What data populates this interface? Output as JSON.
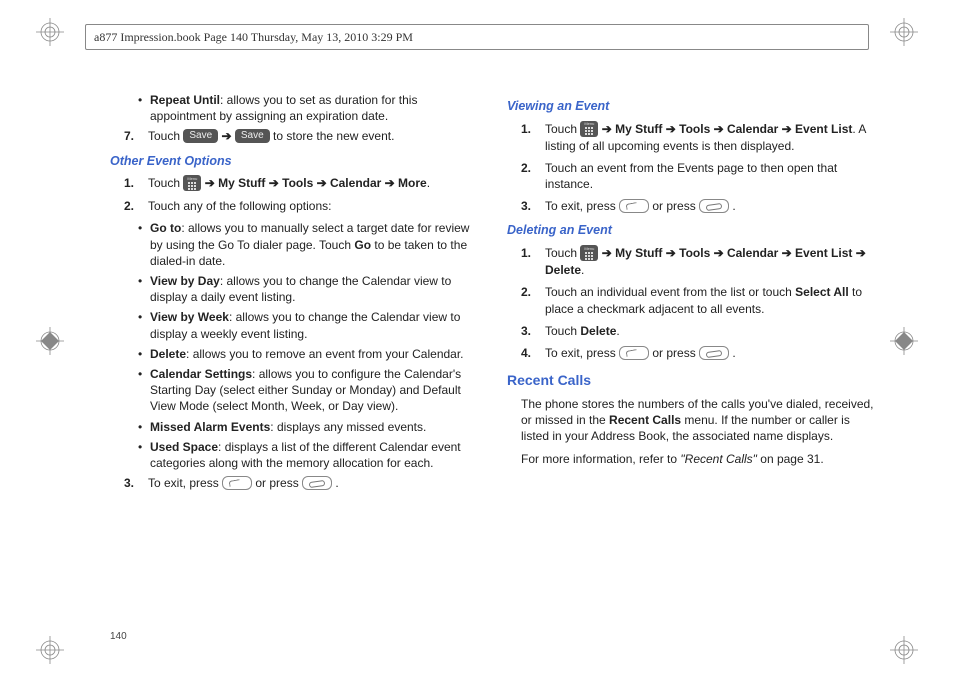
{
  "header": "a877 Impression.book  Page 140  Thursday, May 13, 2010  3:29 PM",
  "page_number": "140",
  "btn": {
    "save": "Save",
    "menu": "Menu"
  },
  "left": {
    "repeat_until_b": "Repeat Until",
    "repeat_until_t": ": allows you to set as duration for this appointment by assigning an expiration date.",
    "step7_n": "7.",
    "step7_a": "Touch ",
    "step7_b": " to store the new event.",
    "h_other": "Other Event Options",
    "s1_n": "1.",
    "s1_a": "Touch ",
    "s1_b": " ➔ My Stuff ➔ Tools ➔ Calendar ➔ More",
    "s1_c": ".",
    "s2_n": "2.",
    "s2_t": "Touch any of the following options:",
    "goto_b": "Go to",
    "goto_t": ": allows you to manually select a target date for review by using the Go To dialer page. Touch ",
    "goto_go": "Go",
    "goto_t2": " to be taken to the dialed-in date.",
    "vbd_b": "View by Day",
    "vbd_t": ": allows you to change the Calendar view to display a daily event listing.",
    "vbw_b": "View by Week",
    "vbw_t": ": allows you to change the Calendar view to display a weekly event listing.",
    "del_b": "Delete",
    "del_t": ": allows you to remove an event from your Calendar.",
    "cs_b": "Calendar Settings",
    "cs_t": ": allows you to configure the Calendar's Starting Day (select either Sunday or Monday) and Default View Mode (select Month, Week, or Day view).",
    "mae_b": "Missed Alarm Events",
    "mae_t": ": displays any missed events.",
    "us_b": "Used Space",
    "us_t": ": displays a list of the different Calendar event categories along with the memory allocation for each.",
    "s3_n": "3.",
    "s3_a": "To exit, press ",
    "s3_b": " or press ",
    "s3_c": " ."
  },
  "right": {
    "h_view": "Viewing an Event",
    "v1_n": "1.",
    "v1_a": "Touch ",
    "v1_b": " ➔ My Stuff ➔ Tools ➔ Calendar ➔ Event List",
    "v1_c": ". A listing of all upcoming events is then displayed.",
    "v2_n": "2.",
    "v2_t": "Touch an event from the Events page to then open that instance.",
    "v3_n": "3.",
    "v3_a": "To exit, press ",
    "v3_b": " or press ",
    "v3_c": " .",
    "h_del": "Deleting an Event",
    "d1_n": "1.",
    "d1_a": "Touch ",
    "d1_b": " ➔ My Stuff ➔ Tools ➔ Calendar ➔ Event List ➔ Delete",
    "d1_c": ".",
    "d2_n": "2.",
    "d2_a": "Touch an individual event from the list or touch ",
    "d2_b": "Select All",
    "d2_c": " to place a checkmark adjacent to all events.",
    "d3_n": "3.",
    "d3_a": "Touch ",
    "d3_b": "Delete",
    "d3_c": ".",
    "d4_n": "4.",
    "d4_a": "To exit, press ",
    "d4_b": " or press ",
    "d4_c": " .",
    "h_recent": "Recent Calls",
    "rc_p1a": "The phone stores the numbers of the calls you've dialed, received, or missed in the ",
    "rc_p1b": "Recent Calls",
    "rc_p1c": " menu. If the number or caller is listed in your Address Book, the associated name displays.",
    "rc_p2a": "For more information, refer to ",
    "rc_p2b": "\"Recent Calls\"",
    "rc_p2c": "  on page 31."
  }
}
